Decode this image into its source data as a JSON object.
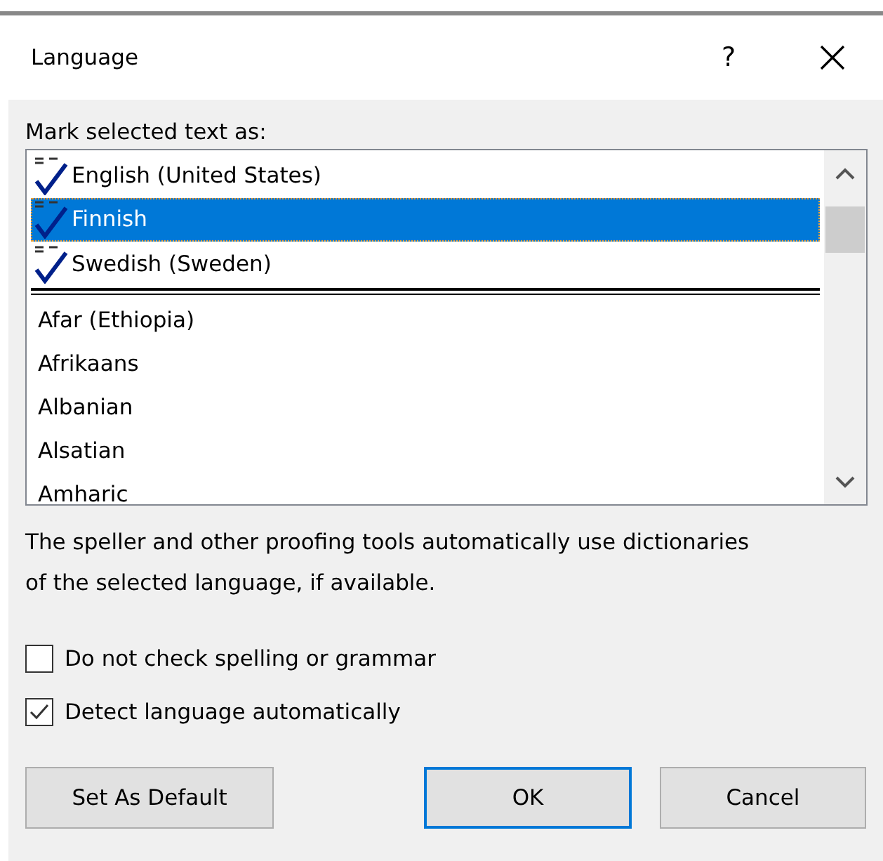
{
  "window": {
    "title": "Language",
    "help_button": "?"
  },
  "list_label": "Mark selected text as:",
  "used_languages": [
    {
      "label": "English (United States)",
      "selected": false
    },
    {
      "label": "Finnish",
      "selected": true
    },
    {
      "label": "Swedish (Sweden)",
      "selected": false
    }
  ],
  "languages": [
    {
      "label": "Afar (Ethiopia)",
      "selected": false
    },
    {
      "label": "Afrikaans",
      "selected": false
    },
    {
      "label": "Albanian",
      "selected": false
    },
    {
      "label": "Alsatian",
      "selected": false
    },
    {
      "label": "Amharic",
      "selected": false
    }
  ],
  "description": "The speller and other proofing tools automatically use dictionaries of the selected language, if available.",
  "options": [
    {
      "label": "Do not check spelling or grammar",
      "checked": false
    },
    {
      "label": "Detect language automatically",
      "checked": true
    }
  ],
  "buttons": [
    {
      "label": "Set As Default",
      "default": false
    },
    {
      "label": "OK",
      "default": true
    },
    {
      "label": "Cancel",
      "default": false
    }
  ]
}
